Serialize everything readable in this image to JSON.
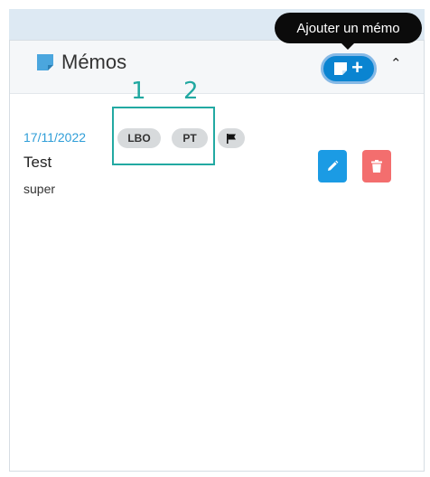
{
  "header": {
    "title": "Mémos",
    "add_tooltip": "Ajouter un mémo",
    "plus_glyph": "+",
    "collapse_glyph": "⌃"
  },
  "memo": {
    "date": "17/11/2022",
    "tags": [
      "LBO",
      "PT"
    ],
    "title": "Test",
    "body": "super"
  },
  "annotation": {
    "labels": [
      "1",
      "2"
    ]
  },
  "colors": {
    "accent": "#0a84d1",
    "date": "#2f9ed8",
    "edit": "#1b9be4",
    "delete": "#f36e6e",
    "annotation": "#22a9a2",
    "memo_icon": "#4ba6de"
  },
  "icons": {
    "memo": "sticky-note-icon",
    "add": "add-memo-icon",
    "collapse": "chevron-up-icon",
    "flag": "flag-icon",
    "edit": "pencil-icon",
    "delete": "trash-icon"
  }
}
